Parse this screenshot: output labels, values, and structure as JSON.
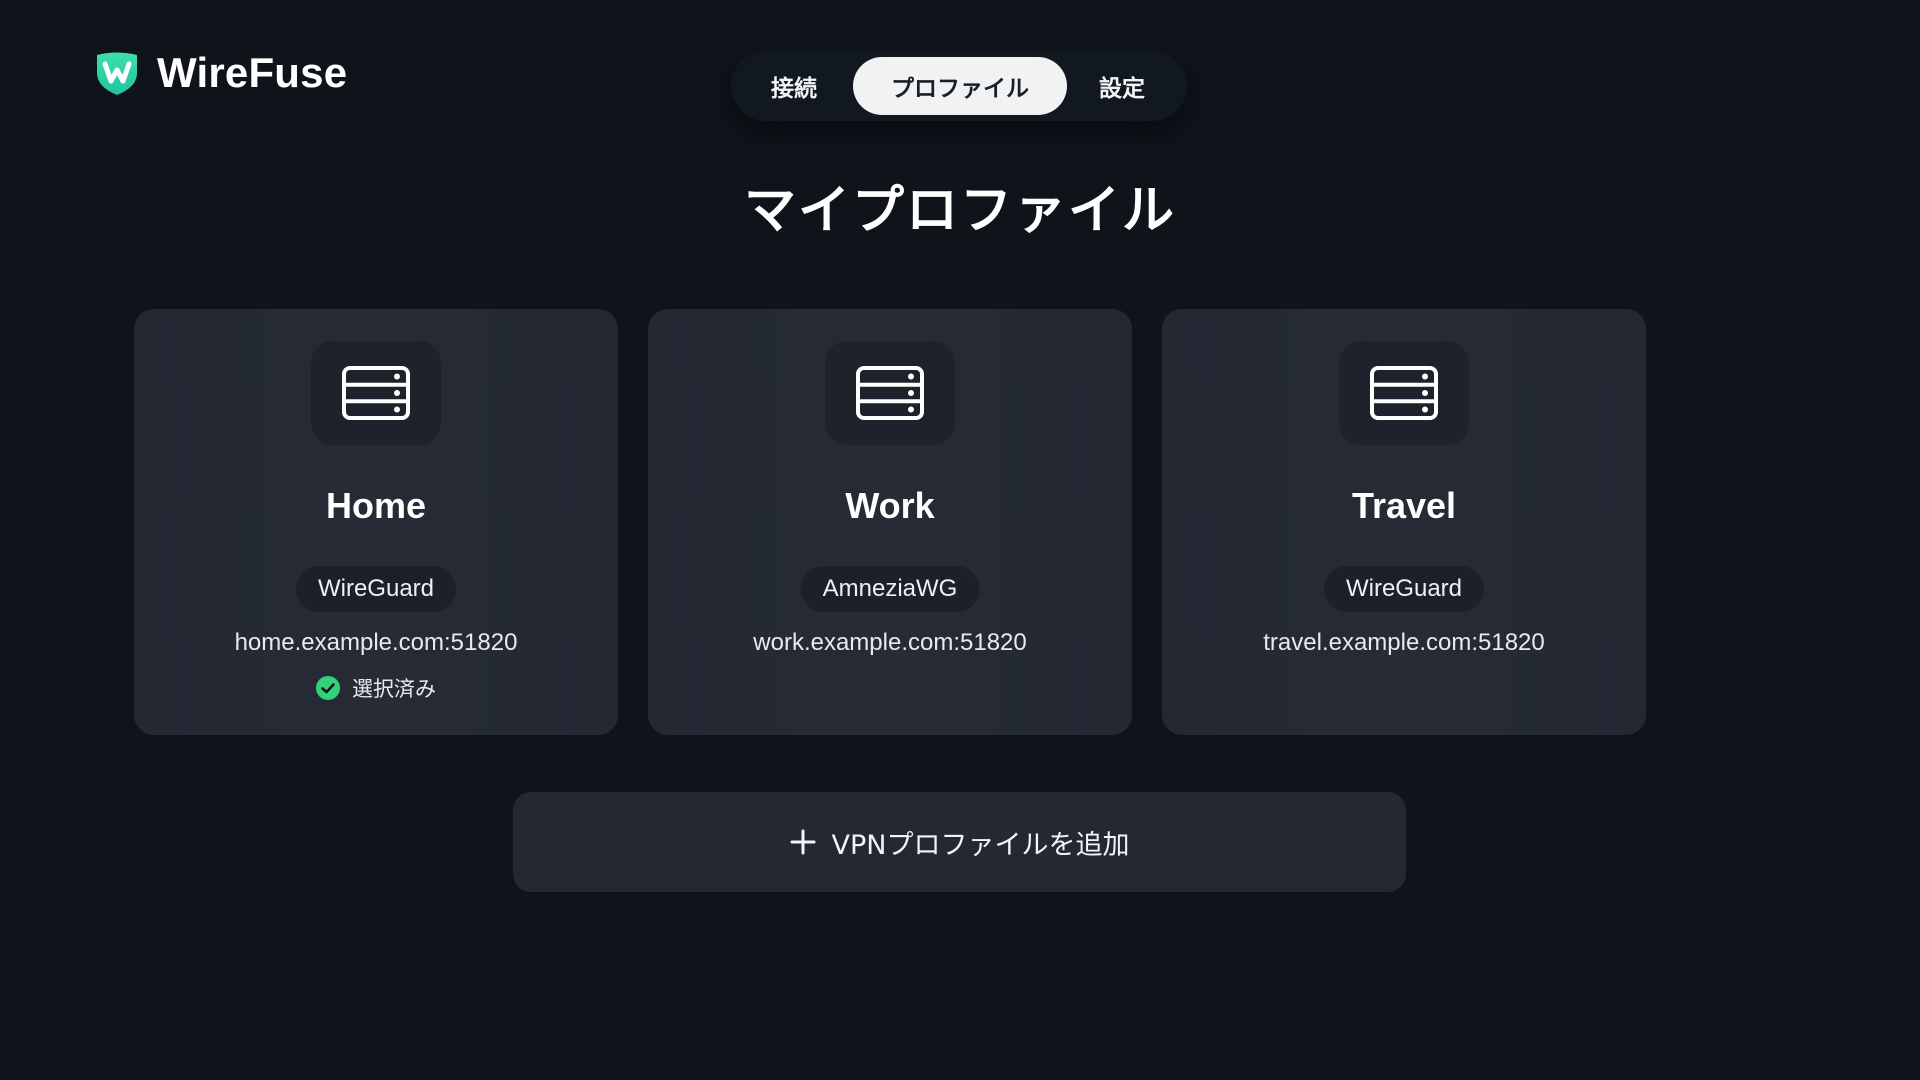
{
  "app": {
    "name": "WireFuse",
    "brand_color": "#2fd49a",
    "logo_icon": "shield-w-logo"
  },
  "nav": {
    "tabs": [
      {
        "label": "接続",
        "active": false
      },
      {
        "label": "プロファイル",
        "active": true
      },
      {
        "label": "設定",
        "active": false
      }
    ]
  },
  "main": {
    "title": "マイプロファイル",
    "profiles": [
      {
        "name": "Home",
        "protocol": "WireGuard",
        "endpoint": "home.example.com:51820",
        "selected": true,
        "icon": "server-icon"
      },
      {
        "name": "Work",
        "protocol": "AmneziaWG",
        "endpoint": "work.example.com:51820",
        "selected": false,
        "icon": "server-icon"
      },
      {
        "name": "Travel",
        "protocol": "WireGuard",
        "endpoint": "travel.example.com:51820",
        "selected": false,
        "icon": "server-icon"
      }
    ],
    "selected_label": "選択済み",
    "selected_color": "#33d17a",
    "add_button_label": "VPNプロファイルを追加",
    "add_icon": "plus-icon"
  }
}
